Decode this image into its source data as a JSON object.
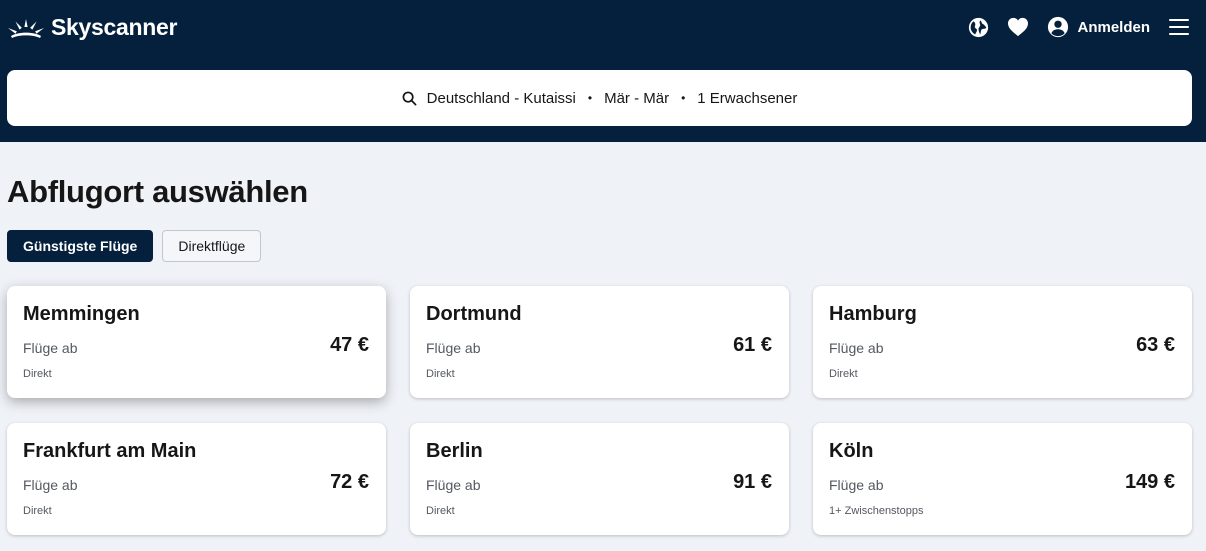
{
  "brand": {
    "name": "Skyscanner"
  },
  "header": {
    "login_label": "Anmelden"
  },
  "search": {
    "route": "Deutschland - Kutaissi",
    "dates": "Mär - Mär",
    "travellers": "1 Erwachsener",
    "separator": "•"
  },
  "page": {
    "title": "Abflugort auswählen"
  },
  "filters": [
    {
      "label": "Günstigste Flüge",
      "active": true
    },
    {
      "label": "Direktflüge",
      "active": false
    }
  ],
  "results": [
    {
      "city": "Memmingen",
      "from_label": "Flüge ab",
      "price": "47 €",
      "stops": "Direkt"
    },
    {
      "city": "Dortmund",
      "from_label": "Flüge ab",
      "price": "61 €",
      "stops": "Direkt"
    },
    {
      "city": "Hamburg",
      "from_label": "Flüge ab",
      "price": "63 €",
      "stops": "Direkt"
    },
    {
      "city": "Frankfurt am Main",
      "from_label": "Flüge ab",
      "price": "72 €",
      "stops": "Direkt"
    },
    {
      "city": "Berlin",
      "from_label": "Flüge ab",
      "price": "91 €",
      "stops": "Direkt"
    },
    {
      "city": "Köln",
      "from_label": "Flüge ab",
      "price": "149 €",
      "stops": "1+ Zwischenstopps"
    }
  ],
  "colors": {
    "header_bg": "#05203c",
    "page_bg": "#eff3f8",
    "text": "#161616"
  },
  "icons": [
    "skyscanner-logo-icon",
    "globe-icon",
    "heart-icon",
    "user-icon",
    "menu-icon",
    "search-icon"
  ]
}
